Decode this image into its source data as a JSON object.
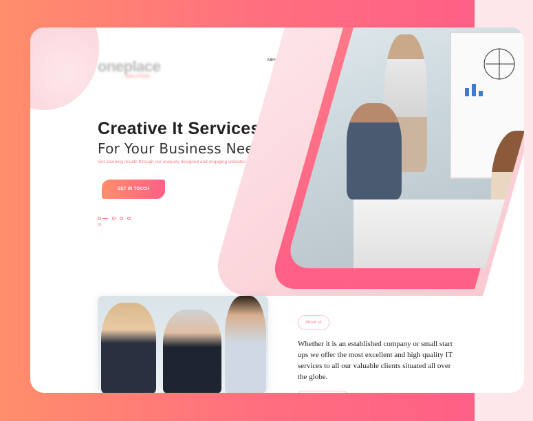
{
  "logo": {
    "main": "oneplace",
    "sub": "SOLUTION"
  },
  "nav": {
    "menu_label": "MENU"
  },
  "hero": {
    "title": "Creative It Services",
    "subtitle": "For Your Business Needs",
    "tagline": "Get stunning results through our uniquely designed and engaging websites",
    "cta_label": "GET IN TOUCH",
    "slide_number": "01"
  },
  "about": {
    "badge": "About us",
    "text": "Whether it is an established company or small start ups we offer the most excellent and high quality IT services to all our valuable clients situated all over the globe."
  },
  "colors": {
    "accent_start": "#ff8e6b",
    "accent_end": "#ff5f86",
    "background_pink": "#fde7ea"
  }
}
